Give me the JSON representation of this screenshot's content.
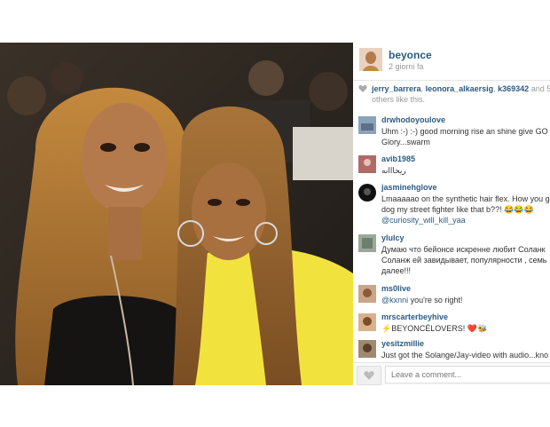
{
  "post": {
    "username": "beyonce",
    "time": "2 giorni fa"
  },
  "likes": {
    "users": [
      "jerry_barrera",
      "leonora_alkaersig",
      "k369342"
    ],
    "suffix": "and 5",
    "rest": "others like this."
  },
  "comments": [
    {
      "user": "drwhodoyoulove",
      "lines": [
        "Uhm :-) :-) good morning rise an shine give GO",
        "Glory...swarm"
      ]
    },
    {
      "user": "avib1985",
      "lines": [
        "ريحااانه"
      ]
    },
    {
      "user": "jasminehglove",
      "lines": [
        "Lmaaaaao on the synthetic hair flex. How you g",
        "dog my street fighter like that b??! 😂😂😂"
      ],
      "mention": "@curiosity_will_kill_yaa"
    },
    {
      "user": "ylulcy",
      "lines": [
        "Думаю что бейонсе искренне любит Соланк",
        "Соланж ей завидывает, популярности , семь",
        "далее!!!"
      ]
    },
    {
      "user": "ms0live",
      "lines": [
        " you're so right!"
      ],
      "mention_inline": "@kxnni"
    },
    {
      "user": "mrscarterbeyhive",
      "lines": [
        "⚡BEYONCÉLOVERS! ❤️🐝"
      ]
    },
    {
      "user": "yesitzmillie",
      "lines": [
        "Just got the Solange/Jay-video with audio...kno"
      ]
    }
  ],
  "footer": {
    "placeholder": "Leave a comment..."
  },
  "colors": {
    "link": "#2a5b84",
    "muted": "#999999"
  }
}
